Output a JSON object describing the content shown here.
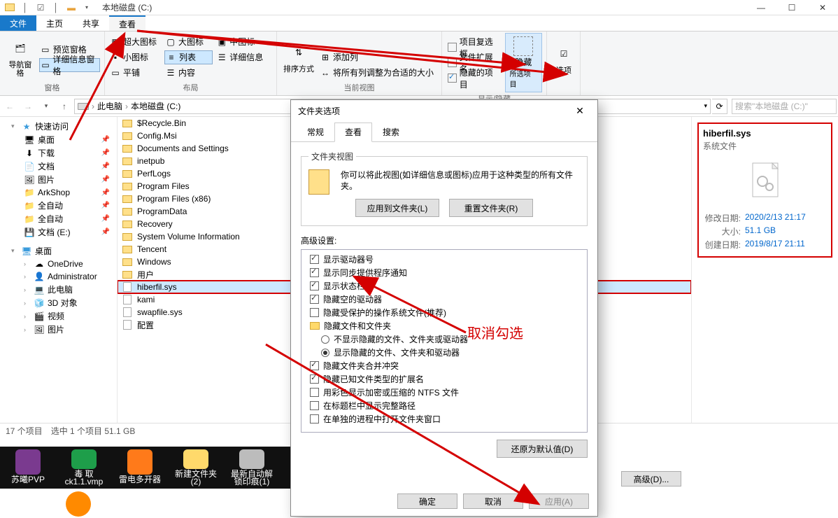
{
  "window": {
    "title": "本地磁盘 (C:)",
    "min": "—",
    "max": "☐",
    "close": "✕"
  },
  "tabs": {
    "file": "文件",
    "home": "主页",
    "share": "共享",
    "view": "查看"
  },
  "ribbon": {
    "panes": {
      "nav": "导航窗格",
      "preview": "预览窗格",
      "details": "详细信息窗格",
      "panes_label": "窗格"
    },
    "layout": {
      "xlarge": "超大图标",
      "large": "大图标",
      "medium": "中图标",
      "small": "小图标",
      "list": "列表",
      "details": "详细信息",
      "tiles": "平铺",
      "content": "内容",
      "label": "布局"
    },
    "current": {
      "sort": "排序方式",
      "addcol": "添加列",
      "autofit": "将所有列调整为合适的大小",
      "label": "当前视图"
    },
    "showhide": {
      "itemcheck": "项目复选框",
      "ext": "文件扩展名",
      "hidden": "隐藏的项目",
      "hidebtn": "隐藏",
      "selected": "所选项目",
      "label": "显示/隐藏"
    },
    "options": "选项"
  },
  "nav": {
    "crumbs": [
      "此电脑",
      "本地磁盘 (C:)"
    ],
    "search_placeholder": "搜索\"本地磁盘 (C:)\""
  },
  "tree": {
    "quick": "快速访问",
    "quick_items": [
      {
        "name": "桌面"
      },
      {
        "name": "下载"
      },
      {
        "name": "文档"
      },
      {
        "name": "图片"
      },
      {
        "name": "ArkShop"
      },
      {
        "name": "全自动"
      },
      {
        "name": "全自动"
      },
      {
        "name": "文档 (E:)"
      }
    ],
    "desktop": "桌面",
    "desk_items": [
      {
        "name": "OneDrive"
      },
      {
        "name": "Administrator"
      },
      {
        "name": "此电脑"
      },
      {
        "name": "3D 对象"
      },
      {
        "name": "视频"
      },
      {
        "name": "图片"
      }
    ]
  },
  "files": [
    "$Recycle.Bin",
    "Config.Msi",
    "Documents and Settings",
    "inetpub",
    "PerfLogs",
    "Program Files",
    "Program Files (x86)",
    "ProgramData",
    "Recovery",
    "System Volume Information",
    "Tencent",
    "Windows",
    "用户",
    "hiberfil.sys",
    "kami",
    "swapfile.sys",
    "配置"
  ],
  "selected_index": 13,
  "preview": {
    "name": "hiberfil.sys",
    "type": "系统文件",
    "modified_k": "修改日期:",
    "modified_v": "2020/2/13 21:17",
    "size_k": "大小:",
    "size_v": "51.1 GB",
    "created_k": "创建日期:",
    "created_v": "2019/8/17 21:11"
  },
  "status": {
    "count": "17 个项目",
    "sel": "选中 1 个项目  51.1 GB"
  },
  "dialog": {
    "title": "文件夹选项",
    "tabs": [
      "常规",
      "查看",
      "搜索"
    ],
    "fv_legend": "文件夹视图",
    "fv_desc": "你可以将此视图(如详细信息或图标)应用于这种类型的所有文件夹。",
    "apply_folders": "应用到文件夹(L)",
    "reset_folders": "重置文件夹(R)",
    "adv_label": "高级设置:",
    "adv": [
      {
        "t": "chk",
        "on": true,
        "lvl": 1,
        "text": "显示驱动器号"
      },
      {
        "t": "chk",
        "on": true,
        "lvl": 1,
        "text": "显示同步提供程序通知"
      },
      {
        "t": "chk",
        "on": true,
        "lvl": 1,
        "text": "显示状态栏"
      },
      {
        "t": "chk",
        "on": true,
        "lvl": 1,
        "text": "隐藏空的驱动器"
      },
      {
        "t": "chk",
        "on": false,
        "lvl": 1,
        "text": "隐藏受保护的操作系统文件(推荐)"
      },
      {
        "t": "folder",
        "lvl": 1,
        "text": "隐藏文件和文件夹"
      },
      {
        "t": "radio",
        "on": false,
        "lvl": 2,
        "text": "不显示隐藏的文件、文件夹或驱动器"
      },
      {
        "t": "radio",
        "on": true,
        "lvl": 2,
        "text": "显示隐藏的文件、文件夹和驱动器"
      },
      {
        "t": "chk",
        "on": true,
        "lvl": 1,
        "text": "隐藏文件夹合并冲突"
      },
      {
        "t": "chk",
        "on": true,
        "lvl": 1,
        "text": "隐藏已知文件类型的扩展名"
      },
      {
        "t": "chk",
        "on": false,
        "lvl": 1,
        "text": "用彩色显示加密或压缩的 NTFS 文件"
      },
      {
        "t": "chk",
        "on": false,
        "lvl": 1,
        "text": "在标题栏中显示完整路径"
      },
      {
        "t": "chk",
        "on": false,
        "lvl": 1,
        "text": "在单独的进程中打开文件夹窗口"
      }
    ],
    "restore": "还原为默认值(D)",
    "ok": "确定",
    "cancel": "取消",
    "apply": "应用(A)"
  },
  "anno": {
    "cancel_check": "取消勾选"
  },
  "side_adv": "高级(D)...",
  "taskbar": [
    {
      "name": "苏曦PVP",
      "c": "#7a3a8f"
    },
    {
      "name": "毒 取ck1.1.vmp",
      "c": "#1e9e4a"
    },
    {
      "name": "雷电多开器",
      "c": "#ff7a1a"
    },
    {
      "name": "新建文件夹 (2)",
      "c": "#ffd96b"
    },
    {
      "name": "最新自动解锁印痕(1)",
      "c": "#bcbcbc"
    }
  ]
}
